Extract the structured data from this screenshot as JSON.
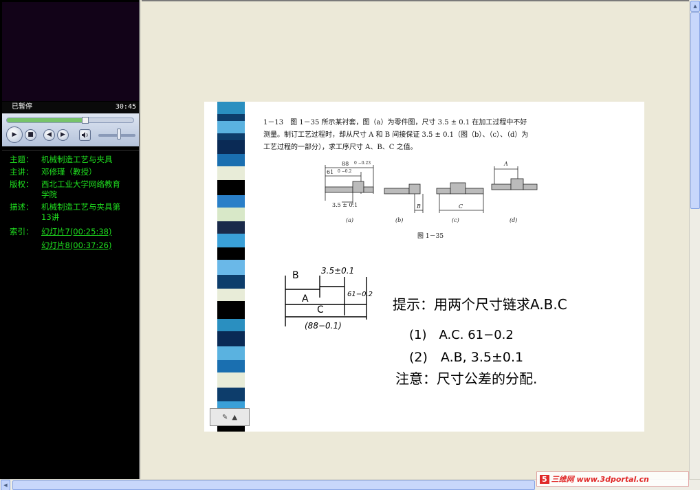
{
  "player": {
    "status": "已暂停",
    "time": "30:45",
    "seek_progress": 0.62,
    "volume_level": 0.55
  },
  "info": {
    "topic_label": "主题：",
    "topic": "机械制造工艺与夹具",
    "lecturer_label": "主讲：",
    "lecturer": "邓修瑾（教授）",
    "copyright_label": "版权：",
    "copyright": "西北工业大学网络教育学院",
    "desc_label": "描述：",
    "desc": "机械制造工艺与夹具第13讲",
    "index_label": "索引：",
    "index_items": [
      "幻灯片7(00:25:38)",
      "幻灯片8(00:37:26)"
    ]
  },
  "slide": {
    "problem_line1": "1－13　图 1－35 所示某衬套，图（a）为零件图，尺寸 3.5 ± 0.1 在加工过程中不好",
    "problem_line2": "测量。制订工艺过程时，却从尺寸 A 和 B 间接保证 3.5 ± 0.1（图（b）、（c）、（d）为",
    "problem_line3": "工艺过程的一部分），求工序尺寸 A、B、C 之值。",
    "fig_dim_88": "88",
    "fig_tol_88": "0 −0.23",
    "fig_dim_61": "61",
    "fig_tol_61": "0 −0.2",
    "fig_dim_35": "3.5 ± 0.1",
    "fig_label_a": "(a)",
    "fig_label_b": "(b)",
    "fig_label_c": "(c)",
    "fig_label_d": "(d)",
    "fig_letter_A": "A",
    "fig_letter_B": "B",
    "fig_letter_C": "C",
    "fig_title": "图 1－35",
    "hand_B": "B",
    "hand_35": "3.5±0.1",
    "hand_A": "A",
    "hand_61": "61−0.2",
    "hand_C": "C",
    "hand_88": "(88−0.1)",
    "hand_hint": "提示：用两个尺寸链求A.B.C",
    "hand_step1": "(1)　A.C. 61−0.2",
    "hand_step2": "(2)　A.B, 3.5±0.1",
    "hand_note": "注意：尺寸公差的分配."
  },
  "watermark": {
    "badge": "5",
    "text": "三维网 www.3dportal.cn"
  }
}
